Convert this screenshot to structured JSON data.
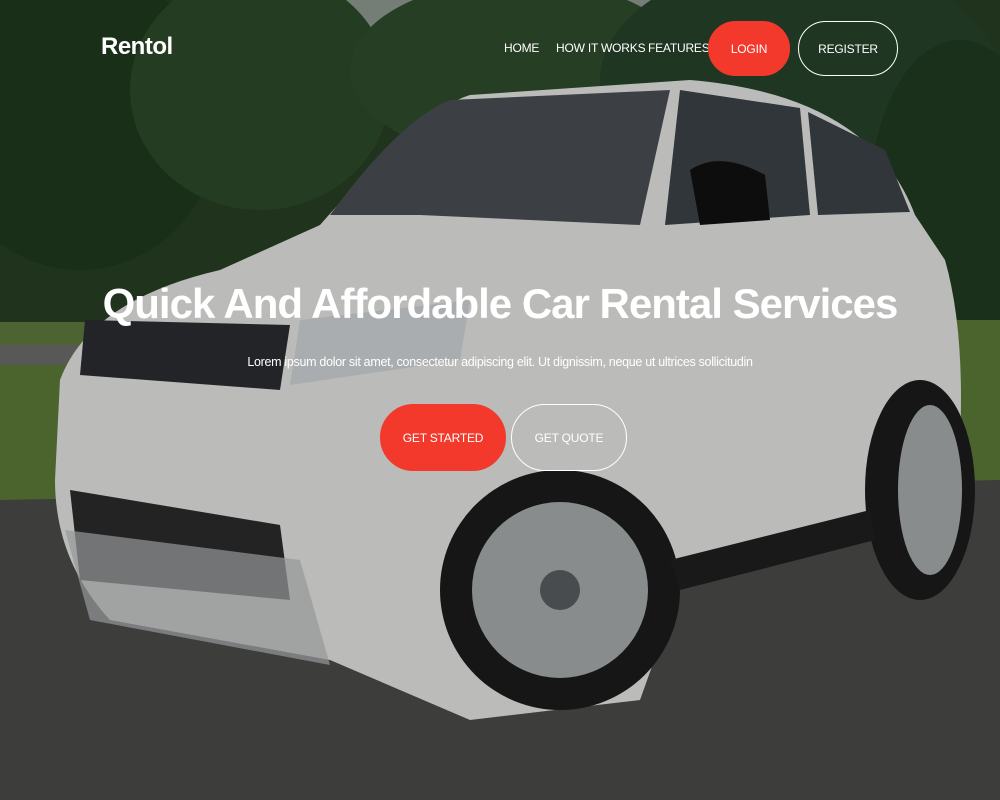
{
  "brand": {
    "name": "Rentol"
  },
  "nav": {
    "items": [
      {
        "label": "HOME"
      },
      {
        "label": "HOW IT WORKS"
      },
      {
        "label": "FEATURES"
      }
    ],
    "login_label": "LOGIN",
    "register_label": "REGISTER"
  },
  "hero": {
    "title": "Quick And Affordable Car Rental Services",
    "subtitle": "Lorem ipsum dolor sit amet, consectetur adipiscing elit. Ut dignissim, neque ut ultrices sollicitudin",
    "primary_cta": "GET STARTED",
    "secondary_cta": "GET QUOTE"
  },
  "colors": {
    "accent": "#f3392c",
    "text": "#ffffff"
  },
  "icons": {
    "background_image": "white-suv-photo"
  }
}
